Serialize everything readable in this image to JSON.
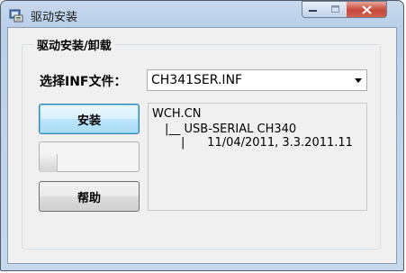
{
  "window": {
    "title": "驱动安装",
    "min_label": "–",
    "max_label": "□",
    "close_label": "✕"
  },
  "group": {
    "title": "驱动安装/卸载"
  },
  "inf": {
    "label": "选择INF文件：",
    "selected": "CH341SER.INF"
  },
  "buttons": {
    "install": "安装",
    "blank": "",
    "help": "帮助"
  },
  "info": {
    "line1": "WCH.CN",
    "line2": "|__ USB-SERIAL CH340",
    "line3": "|      11/04/2011, 3.3.2011.11"
  },
  "icons": {
    "app": "app-installer-icon",
    "dropdown": "chevron-down-icon"
  },
  "colors": {
    "close_button": "#c7483a",
    "focus_button": "#3c7fb1",
    "client_bg": "#f0f0f0"
  }
}
